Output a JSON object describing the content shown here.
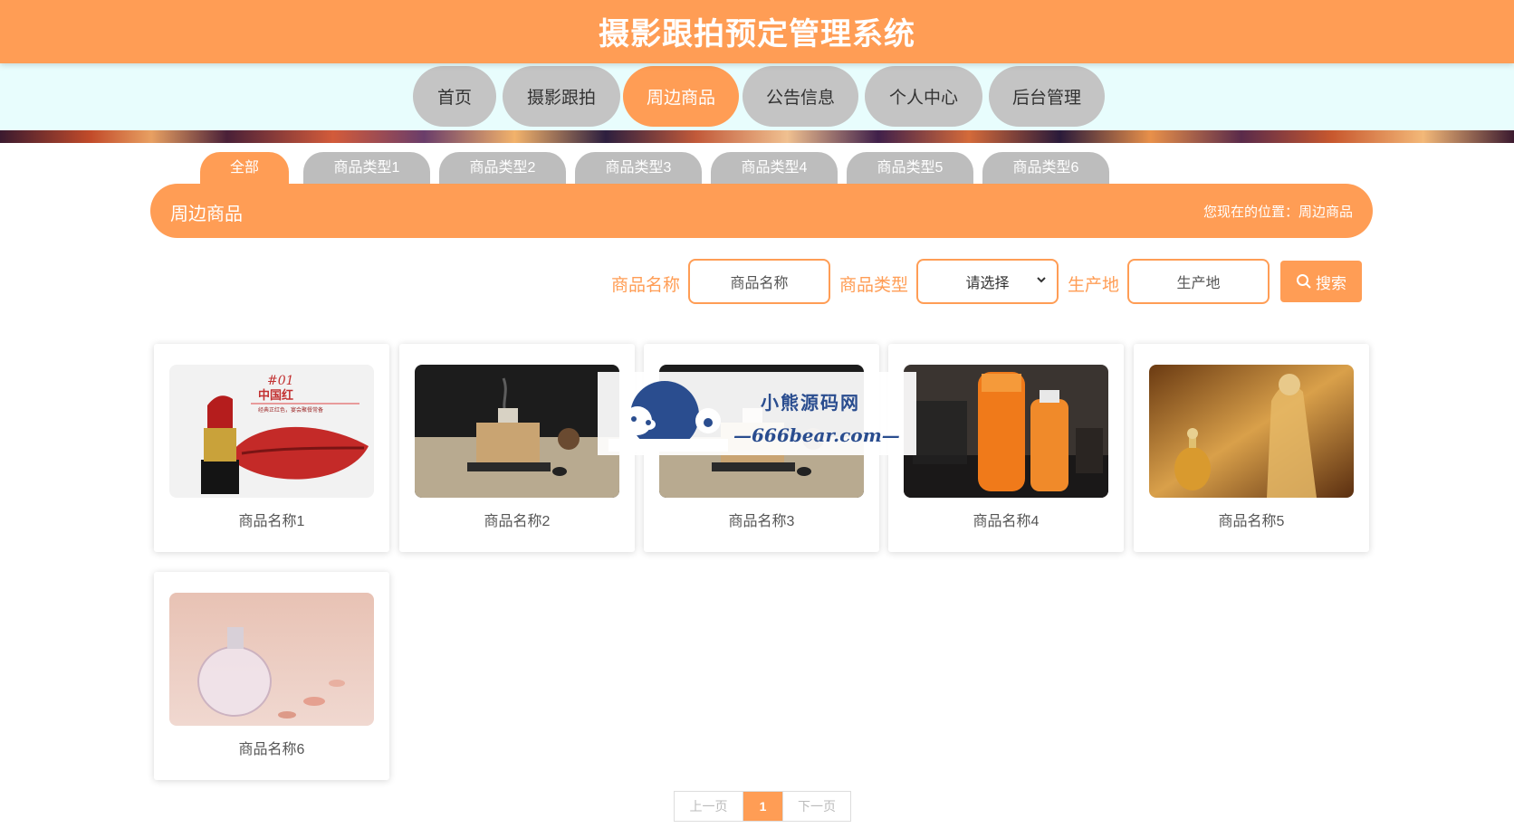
{
  "header": {
    "title": "摄影跟拍预定管理系统"
  },
  "nav": {
    "items": [
      {
        "label": "首页"
      },
      {
        "label": "摄影跟拍"
      },
      {
        "label": "周边商品"
      },
      {
        "label": "公告信息"
      },
      {
        "label": "个人中心"
      },
      {
        "label": "后台管理"
      }
    ],
    "active_index": 2
  },
  "categories": {
    "items": [
      {
        "label": "全部"
      },
      {
        "label": "商品类型1"
      },
      {
        "label": "商品类型2"
      },
      {
        "label": "商品类型3"
      },
      {
        "label": "商品类型4"
      },
      {
        "label": "商品类型5"
      },
      {
        "label": "商品类型6"
      }
    ],
    "active_index": 0
  },
  "section": {
    "title": "周边商品",
    "location": "您现在的位置：周边商品"
  },
  "search": {
    "name_label": "商品名称",
    "name_placeholder": "商品名称",
    "type_label": "商品类型",
    "type_selected": "请选择",
    "origin_label": "生产地",
    "origin_placeholder": "生产地",
    "button_label": "搜索"
  },
  "products": [
    {
      "name": "商品名称1",
      "image": "lipstick-photo"
    },
    {
      "name": "商品名称2",
      "image": "aroma-diffuser-photo"
    },
    {
      "name": "商品名称3",
      "image": "aroma-diffuser-photo"
    },
    {
      "name": "商品名称4",
      "image": "sunscreen-photo"
    },
    {
      "name": "商品名称5",
      "image": "perfume-ad-photo"
    },
    {
      "name": "商品名称6",
      "image": "perfume-bottle-photo"
    }
  ],
  "lipstick_image_text": {
    "tag": "#01",
    "title": "中国红",
    "subtitle": "经典正红色，宴会聚餐常备"
  },
  "pagination": {
    "prev": "上一页",
    "current": "1",
    "next": "下一页"
  },
  "watermark": {
    "line1": "小熊源码网",
    "line2": "—666bear.com—"
  },
  "colors": {
    "accent": "#ff9d55",
    "nav_bg": "#e8fdfd",
    "inactive": "#c4c4c4"
  }
}
